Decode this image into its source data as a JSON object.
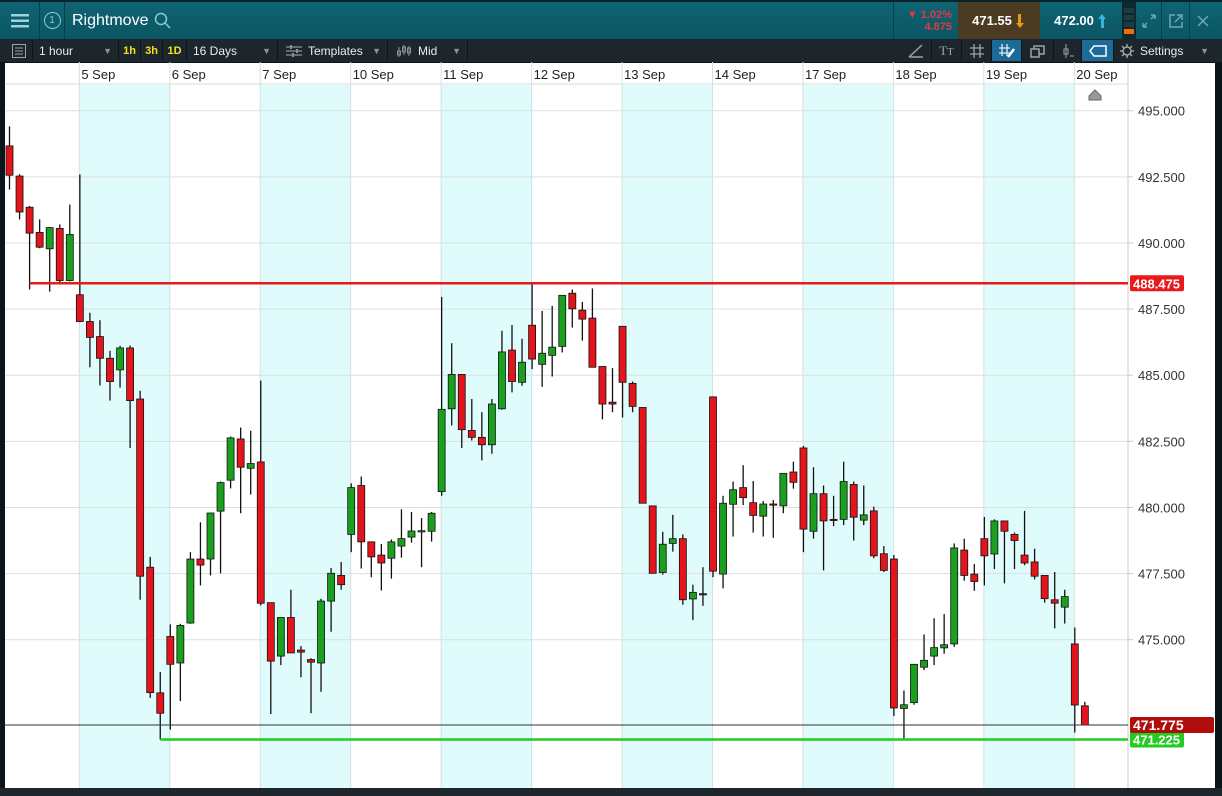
{
  "header": {
    "menu_icon": "hamburger-icon",
    "link_icon": "circled-1-icon",
    "link_number": "1",
    "title": "Rightmove",
    "search_icon": "search-icon",
    "change_percent": "1.02%",
    "change_direction": "down",
    "change_value": "4.875",
    "bid": "471.55",
    "ask": "472.00",
    "bid_arrow": "down-arrow-icon",
    "ask_arrow": "up-arrow-icon",
    "colors": {
      "down": "#e2393f",
      "bid_bg": "#4b3b22",
      "bid_arrow": "#e39a1b",
      "ask_arrow": "#35b5d8"
    }
  },
  "toolbar": {
    "interval": "1 hour",
    "quick_intervals": [
      "1h",
      "3h",
      "1D"
    ],
    "range": "16 Days",
    "templates": "Templates",
    "price_type": "Mid",
    "settings": "Settings"
  },
  "chart_data": {
    "type": "candlestick",
    "instrument": "Rightmove",
    "y_axis": {
      "min": 471,
      "max": 496,
      "ticks": [
        "495.000",
        "492.500",
        "490.000",
        "487.500",
        "485.000",
        "482.500",
        "480.000",
        "477.500",
        "475.000"
      ],
      "tick_values": [
        495,
        492.5,
        490,
        487.5,
        485,
        482.5,
        480,
        477.5,
        475
      ],
      "position": "right"
    },
    "x_ticks": [
      {
        "label": "5 Sep",
        "index": 7,
        "shaded": true
      },
      {
        "label": "6 Sep",
        "index": 16,
        "shaded": false
      },
      {
        "label": "7 Sep",
        "index": 25,
        "shaded": true
      },
      {
        "label": "10 Sep",
        "index": 34,
        "shaded": false
      },
      {
        "label": "11 Sep",
        "index": 43,
        "shaded": true
      },
      {
        "label": "12 Sep",
        "index": 52,
        "shaded": false
      },
      {
        "label": "13 Sep",
        "index": 61,
        "shaded": true
      },
      {
        "label": "14 Sep",
        "index": 70,
        "shaded": false
      },
      {
        "label": "17 Sep",
        "index": 79,
        "shaded": true
      },
      {
        "label": "18 Sep",
        "index": 88,
        "shaded": false
      },
      {
        "label": "19 Sep",
        "index": 97,
        "shaded": true
      },
      {
        "label": "20 Sep",
        "index": 106,
        "shaded": false
      }
    ],
    "grid": true,
    "colors": {
      "up": "#1aa01e",
      "down": "#e3141b",
      "shade": "#e0fbfc",
      "high_line": "#e81a1a",
      "low_line": "#22cc22",
      "current_label": "#b00d0d"
    },
    "high_line": {
      "value": 488.475,
      "label": "488.475"
    },
    "low_line": {
      "value": 471.225,
      "label": "471.225"
    },
    "current_price": {
      "value": 471.775,
      "label": "471.775"
    },
    "candles_ohlc": [
      [
        493.67,
        494.41,
        492.02,
        492.56
      ],
      [
        492.53,
        492.6,
        490.89,
        491.17
      ],
      [
        491.35,
        491.4,
        488.24,
        490.37
      ],
      [
        490.4,
        490.89,
        489.8,
        489.84
      ],
      [
        489.78,
        490.6,
        488.16,
        490.58
      ],
      [
        490.55,
        490.7,
        488.5,
        488.58
      ],
      [
        488.58,
        491.45,
        488.55,
        490.32
      ],
      [
        488.04,
        492.59,
        487.0,
        487.03
      ],
      [
        487.03,
        487.36,
        485.3,
        486.43
      ],
      [
        486.46,
        487.08,
        484.61,
        485.64
      ],
      [
        485.64,
        485.92,
        484.04,
        484.76
      ],
      [
        485.2,
        486.11,
        484.53,
        486.03
      ],
      [
        486.03,
        486.12,
        482.25,
        484.04
      ],
      [
        484.1,
        484.41,
        476.51,
        477.4
      ],
      [
        477.74,
        478.13,
        472.8,
        473.0
      ],
      [
        472.99,
        473.78,
        471.225,
        472.22
      ],
      [
        475.12,
        475.58,
        471.6,
        474.07
      ],
      [
        474.12,
        475.6,
        472.68,
        475.54
      ],
      [
        475.63,
        478.31,
        475.6,
        478.05
      ],
      [
        478.05,
        479.44,
        477.05,
        477.82
      ],
      [
        478.05,
        479.8,
        477.43,
        479.79
      ],
      [
        479.86,
        480.98,
        477.51,
        480.94
      ],
      [
        481.03,
        482.68,
        480.72,
        482.63
      ],
      [
        482.59,
        483.02,
        479.78,
        481.52
      ],
      [
        481.48,
        482.9,
        480.49,
        481.66
      ],
      [
        481.72,
        484.8,
        476.3,
        476.38
      ],
      [
        476.4,
        476.4,
        472.19,
        474.19
      ],
      [
        474.38,
        475.84,
        474.04,
        475.84
      ],
      [
        475.84,
        476.89,
        474.5,
        474.5
      ],
      [
        474.61,
        474.76,
        473.58,
        474.53
      ],
      [
        474.25,
        474.3,
        472.22,
        474.15
      ],
      [
        474.12,
        476.55,
        473.03,
        476.46
      ],
      [
        476.46,
        477.71,
        475.3,
        477.51
      ],
      [
        477.43,
        477.94,
        476.89,
        477.08
      ],
      [
        478.98,
        480.91,
        478.31,
        480.75
      ],
      [
        480.83,
        481.17,
        477.69,
        478.7
      ],
      [
        478.7,
        478.7,
        477.36,
        478.13
      ],
      [
        478.2,
        478.62,
        476.86,
        477.9
      ],
      [
        478.08,
        478.79,
        477.31,
        478.7
      ],
      [
        478.54,
        479.93,
        478.1,
        478.82
      ],
      [
        478.88,
        479.83,
        478.67,
        479.11
      ],
      [
        479.11,
        479.6,
        477.74,
        479.12
      ],
      [
        479.1,
        479.83,
        478.71,
        479.78
      ],
      [
        480.6,
        487.96,
        480.44,
        483.71
      ],
      [
        483.73,
        486.21,
        483.1,
        485.03
      ],
      [
        485.03,
        485.03,
        482.25,
        482.94
      ],
      [
        482.91,
        484.1,
        482.53,
        482.65
      ],
      [
        482.65,
        483.6,
        481.78,
        482.37
      ],
      [
        482.37,
        484.1,
        482.03,
        483.91
      ],
      [
        483.73,
        486.68,
        483.7,
        485.88
      ],
      [
        485.95,
        486.9,
        484.35,
        484.76
      ],
      [
        484.73,
        486.38,
        484.6,
        485.49
      ],
      [
        486.89,
        488.47,
        485.23,
        485.61
      ],
      [
        485.41,
        487.43,
        484.56,
        485.83
      ],
      [
        485.75,
        487.62,
        484.95,
        486.06
      ],
      [
        486.09,
        488.02,
        485.86,
        488.02
      ],
      [
        488.1,
        488.24,
        486.8,
        487.51
      ],
      [
        487.46,
        487.77,
        486.31,
        487.12
      ],
      [
        487.16,
        488.28,
        485.3,
        485.3
      ],
      [
        485.33,
        485.33,
        483.33,
        483.91
      ],
      [
        483.98,
        485.27,
        483.6,
        483.91
      ],
      [
        486.85,
        486.85,
        483.4,
        484.73
      ],
      [
        484.69,
        484.76,
        483.6,
        483.82
      ],
      [
        483.78,
        483.78,
        480.16,
        480.16
      ],
      [
        480.06,
        480.06,
        477.5,
        477.51
      ],
      [
        477.54,
        479.08,
        477.46,
        478.61
      ],
      [
        478.64,
        479.72,
        478.33,
        478.82
      ],
      [
        478.82,
        478.98,
        476.32,
        476.51
      ],
      [
        476.54,
        477.08,
        475.74,
        476.79
      ],
      [
        476.74,
        477.74,
        476.28,
        476.7
      ],
      [
        484.18,
        484.2,
        477.36,
        477.59
      ],
      [
        477.48,
        480.44,
        476.94,
        480.16
      ],
      [
        480.12,
        480.98,
        478.9,
        480.67
      ],
      [
        480.75,
        481.6,
        480.09,
        480.37
      ],
      [
        480.18,
        481.0,
        479.05,
        479.7
      ],
      [
        479.67,
        480.24,
        478.9,
        480.13
      ],
      [
        480.13,
        480.28,
        478.85,
        480.1
      ],
      [
        480.06,
        481.3,
        479.78,
        481.29
      ],
      [
        481.34,
        481.73,
        480.71,
        480.95
      ],
      [
        482.25,
        482.33,
        478.31,
        479.18
      ],
      [
        479.1,
        481.52,
        478.82,
        480.52
      ],
      [
        480.52,
        480.83,
        477.62,
        479.49
      ],
      [
        479.55,
        480.44,
        479.29,
        479.53
      ],
      [
        479.55,
        481.73,
        479.33,
        480.98
      ],
      [
        480.87,
        480.98,
        478.75,
        479.63
      ],
      [
        479.52,
        480.83,
        479.33,
        479.72
      ],
      [
        479.87,
        480.03,
        478.08,
        478.17
      ],
      [
        478.25,
        478.54,
        477.56,
        477.62
      ],
      [
        478.05,
        478.2,
        472.11,
        472.42
      ],
      [
        472.4,
        473.08,
        471.22,
        472.54
      ],
      [
        472.62,
        474.07,
        472.54,
        474.07
      ],
      [
        473.96,
        475.2,
        473.85,
        474.22
      ],
      [
        474.38,
        475.81,
        474.04,
        474.7
      ],
      [
        474.69,
        475.97,
        474.47,
        474.81
      ],
      [
        474.84,
        478.64,
        474.73,
        478.47
      ],
      [
        478.39,
        478.82,
        477.23,
        477.43
      ],
      [
        477.48,
        477.86,
        476.85,
        477.2
      ],
      [
        478.82,
        479.64,
        477.05,
        478.17
      ],
      [
        478.24,
        479.55,
        477.67,
        479.49
      ],
      [
        479.49,
        479.49,
        477.13,
        479.1
      ],
      [
        478.98,
        479.05,
        477.67,
        478.75
      ],
      [
        478.2,
        479.87,
        477.82,
        477.9
      ],
      [
        477.94,
        478.44,
        477.28,
        477.4
      ],
      [
        477.43,
        477.43,
        476.4,
        476.55
      ],
      [
        476.51,
        477.56,
        475.43,
        476.38
      ],
      [
        476.23,
        476.89,
        475.61,
        476.63
      ],
      [
        474.84,
        475.46,
        471.49,
        472.53
      ],
      [
        472.5,
        472.65,
        471.77,
        471.775
      ]
    ]
  }
}
